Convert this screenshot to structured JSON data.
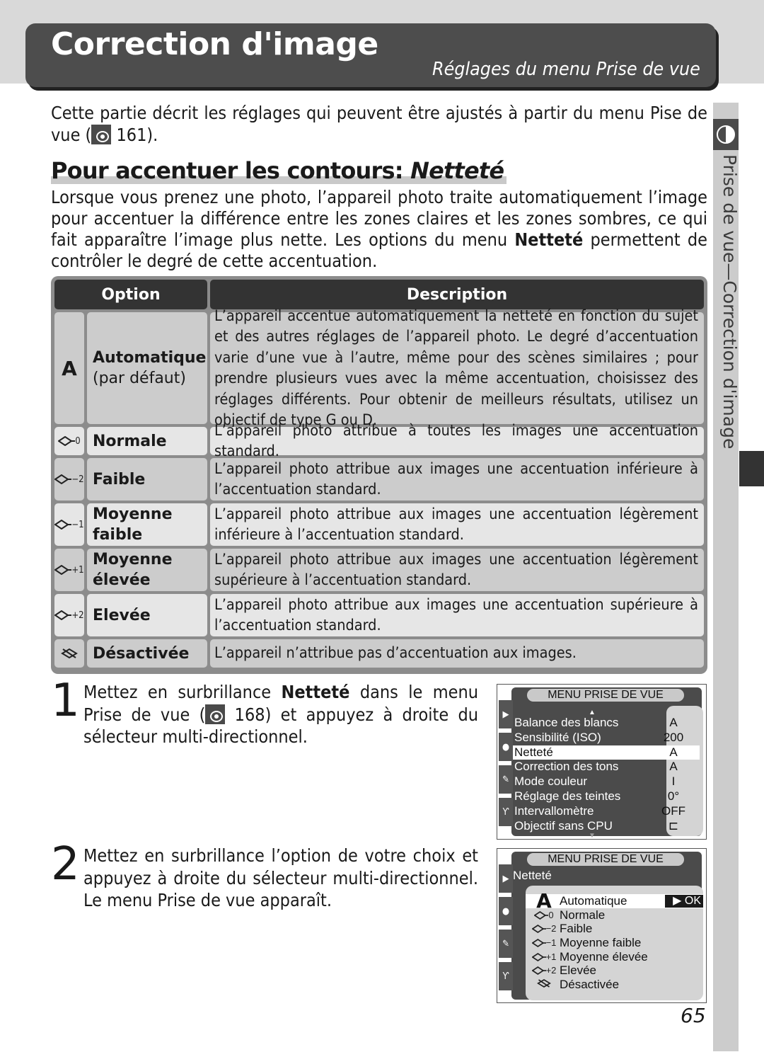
{
  "header": {
    "title": "Correction d'image",
    "subtitle": "Réglages du menu Prise de vue"
  },
  "side_tab": {
    "label": "Prise de vue—Correction d'image",
    "icon": "half-circle-icon"
  },
  "intro": {
    "text_before": "Cette partie décrit les réglages qui peuvent être ajustés à partir du menu Pise de vue (",
    "ref_page": "161",
    "text_after": ")."
  },
  "section": {
    "title_plain": "Pour accentuer les contours: ",
    "title_italic": "Netteté",
    "para_before": "Lorsque vous prenez une photo, l’appareil photo traite automatiquement l’image pour accentuer la différence entre les zones claires et les zones sombres, ce qui fait apparaître l’image plus nette. Les options du menu ",
    "para_bold": "Netteté",
    "para_after": " permettent de contrôler le degré de cette accentuation."
  },
  "table": {
    "headers": [
      "Option",
      "Description"
    ],
    "rows": [
      {
        "icon": "A",
        "name": "Automatique",
        "sub": "(par défaut)",
        "desc": "L’appareil accentue automatiquement la netteté en fonction du sujet et des autres réglages de l’appareil photo. Le degré d’accentuation varie d’une vue à l’autre, même pour des scènes similaires ; pour prendre plusieurs vues avec la même accentuation, choisissez des réglages différents. Pour obtenir de meilleurs résultats, utilisez un objectif de type G ou D."
      },
      {
        "icon": "0",
        "name": "Normale",
        "sub": "",
        "desc": "L’appareil photo attribue à toutes les images une accentuation standard."
      },
      {
        "icon": "−2",
        "name": "Faible",
        "sub": "",
        "desc": "L’appareil photo attribue aux images une accentuation inférieure à l’accentuation standard."
      },
      {
        "icon": "−1",
        "name": "Moyenne faible",
        "sub": "",
        "desc": "L’appareil photo attribue aux images une accentuation légèrement inférieure à l’accentuation standard."
      },
      {
        "icon": "+1",
        "name": "Moyenne élevée",
        "sub": "",
        "desc": "L’appareil photo attribue aux images une accentuation légèrement supérieure à l’accentuation standard."
      },
      {
        "icon": "+2",
        "name": "Elevée",
        "sub": "",
        "desc": "L’appareil photo attribue aux images une accentuation supérieure à l’accentuation standard."
      },
      {
        "icon": "off",
        "name": "Désactivée",
        "sub": "",
        "desc": "L’appareil n’attribue pas d’accentuation aux images."
      }
    ]
  },
  "steps": [
    {
      "num": "1",
      "before": "Mettez en surbrillance ",
      "bold": "Netteté",
      "middle": " dans le menu Prise de vue (",
      "ref_page": "168",
      "after": ") et appuyez à droite du sélecteur multi-directionnel."
    },
    {
      "num": "2",
      "text": "Mettez en surbrillance l’option de votre choix et appuyez à droite du sélecteur multi-directionnel. Le menu Prise de vue apparaît."
    }
  ],
  "lcd1": {
    "title": "MENU PRISE DE VUE",
    "items": [
      {
        "label": "Balance des blancs",
        "value": "A"
      },
      {
        "label": "Sensibilité (ISO)",
        "value": "200"
      },
      {
        "label": "Netteté",
        "value": "A",
        "selected": true
      },
      {
        "label": "Correction des tons",
        "value": "A"
      },
      {
        "label": "Mode couleur",
        "value": "I"
      },
      {
        "label": "Réglage des teintes",
        "value": "0°"
      },
      {
        "label": "Intervallomètre",
        "value": "OFF"
      },
      {
        "label": "Objectif sans CPU",
        "value": "folder-icon"
      }
    ]
  },
  "lcd2": {
    "title": "MENU PRISE DE VUE",
    "heading": "Netteté",
    "ok_label": "▶ OK",
    "items": [
      {
        "icon": "A",
        "label": "Automatique",
        "selected": true
      },
      {
        "icon": "0",
        "label": "Normale"
      },
      {
        "icon": "−2",
        "label": "Faible"
      },
      {
        "icon": "−1",
        "label": "Moyenne faible"
      },
      {
        "icon": "+1",
        "label": "Moyenne élevée"
      },
      {
        "icon": "+2",
        "label": "Elevée"
      },
      {
        "icon": "off",
        "label": "Désactivée"
      }
    ]
  },
  "page_number": "65"
}
